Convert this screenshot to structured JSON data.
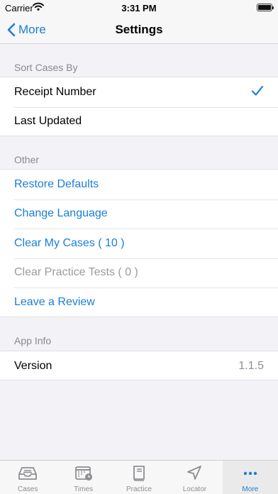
{
  "status_bar": {
    "carrier": "Carrier",
    "time": "3:31 PM"
  },
  "nav": {
    "back_label": "More",
    "title": "Settings"
  },
  "sort_section": {
    "header": "Sort Cases By",
    "items": [
      {
        "label": "Receipt Number",
        "selected": true
      },
      {
        "label": "Last Updated",
        "selected": false
      }
    ]
  },
  "other_section": {
    "header": "Other",
    "items": [
      {
        "label": "Restore Defaults"
      },
      {
        "label": "Change Language"
      },
      {
        "label": "Clear My Cases ( 10 )"
      },
      {
        "label": "Clear Practice Tests ( 0 )"
      },
      {
        "label": "Leave a Review"
      }
    ]
  },
  "app_info_section": {
    "header": "App Info",
    "version_label": "Version",
    "version_value": "1.1.5"
  },
  "tab_bar": {
    "tabs": [
      {
        "label": "Cases",
        "icon": "tray-icon"
      },
      {
        "label": "Times",
        "icon": "calendar-clock-icon"
      },
      {
        "label": "Practice",
        "icon": "book-icon"
      },
      {
        "label": "Locator",
        "icon": "location-arrow-icon"
      },
      {
        "label": "More",
        "icon": "more-dots-icon",
        "active": true
      }
    ]
  },
  "colors": {
    "accent": "#1a7fd6",
    "disabled": "#9b9b9f",
    "background": "#f2f2f7"
  }
}
